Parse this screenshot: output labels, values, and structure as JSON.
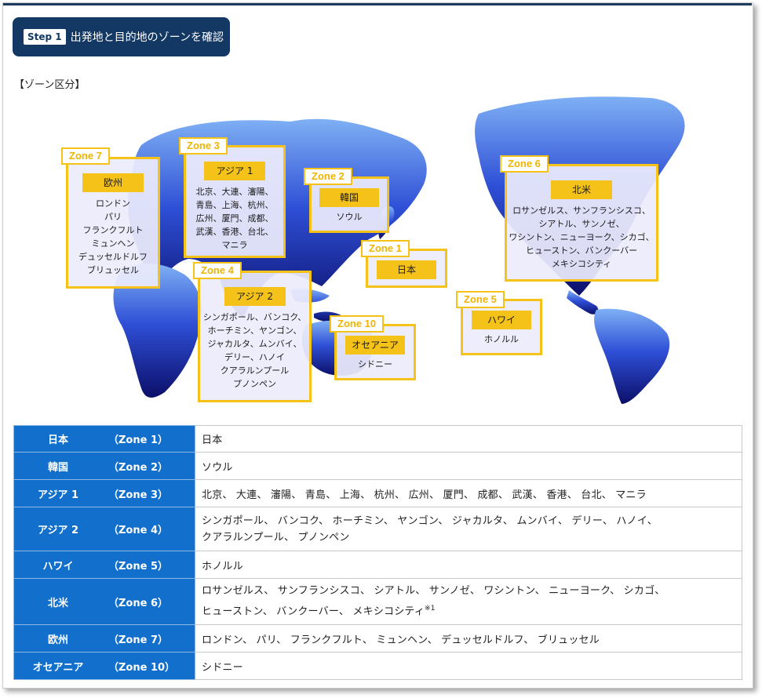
{
  "header": {
    "step_badge": "Step 1",
    "title": "出発地と目的地のゾーンを確認"
  },
  "zone_heading": "【ゾーン区分】",
  "map_zones": [
    {
      "id": "zone7",
      "tag": "Zone 7",
      "region": "欧州",
      "cities": "ロンドン\nパリ\nフランクフルト\nミュンヘン\nデュッセルドルフ\nブリュッセル"
    },
    {
      "id": "zone3",
      "tag": "Zone 3",
      "region": "アジア 1",
      "cities": "北京、大連、瀋陽、\n青島、上海、杭州、\n広州、厦門、成都、\n武漢、香港、台北、\nマニラ"
    },
    {
      "id": "zone2",
      "tag": "Zone 2",
      "region": "韓国",
      "cities": "ソウル"
    },
    {
      "id": "zone1",
      "tag": "Zone 1",
      "region": "日本",
      "cities": ""
    },
    {
      "id": "zone4",
      "tag": "Zone 4",
      "region": "アジア 2",
      "cities": "シンガポール、バンコク、\nホーチミン、ヤンゴン、\nジャカルタ、ムンバイ、\nデリー、ハノイ\nクアラルンプール\nプノンペン"
    },
    {
      "id": "zone10",
      "tag": "Zone 10",
      "region": "オセアニア",
      "cities": "シドニー"
    },
    {
      "id": "zone6",
      "tag": "Zone 6",
      "region": "北米",
      "cities": "ロサンゼルス、サンフランシスコ、\nシアトル、サンノゼ、\nワシントン、ニューヨーク、シカゴ、\nヒューストン、バンクーバー\nメキシコシティ"
    },
    {
      "id": "zone5",
      "tag": "Zone 5",
      "region": "ハワイ",
      "cities": "ホノルル"
    }
  ],
  "table": [
    {
      "name": "日本",
      "code": "（Zone 1）",
      "cities": "日本"
    },
    {
      "name": "韓国",
      "code": "（Zone 2）",
      "cities": "ソウル"
    },
    {
      "name": "アジア 1",
      "code": "（Zone 3）",
      "cities": "北京、 大連、 瀋陽、 青島、 上海、 杭州、 広州、 厦門、 成都、 武漢、 香港、 台北、 マニラ"
    },
    {
      "name": "アジア 2",
      "code": "（Zone 4）",
      "cities": "シンガポール、 バンコク、 ホーチミン、 ヤンゴン、 ジャカルタ、 ムンバイ、 デリー、 ハノイ、\nクアラルンプール、 プノンペン"
    },
    {
      "name": "ハワイ",
      "code": "（Zone 5）",
      "cities": "ホノルル"
    },
    {
      "name": "北米",
      "code": "（Zone 6）",
      "cities": "ロサンゼルス、 サンフランシスコ、 シアトル、 サンノゼ、 ワシントン、 ニューヨーク、 シカゴ、\nヒューストン、 バンクーバー、 メキシコシティ",
      "note": "※1"
    },
    {
      "name": "欧州",
      "code": "（Zone 7）",
      "cities": "ロンドン、 パリ、 フランクフルト、 ミュンヘン、 デュッセルドルフ、 ブリュッセル"
    },
    {
      "name": "オセアニア",
      "code": "（Zone 10）",
      "cities": "シドニー"
    }
  ],
  "colors": {
    "header_bg": "#133864",
    "zone_yellow": "#f5c21a",
    "table_blue": "#1270cc"
  }
}
